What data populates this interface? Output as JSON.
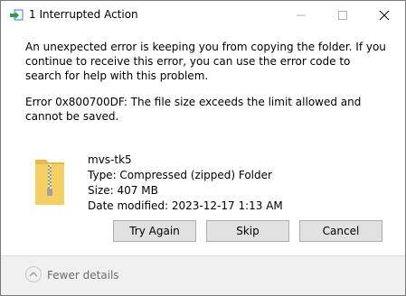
{
  "window": {
    "title": "1 Interrupted Action"
  },
  "message": {
    "line1": "An unexpected error is keeping you from copying the folder. If you continue to receive this error, you can use the error code to search for help with this problem.",
    "line2": "Error 0x800700DF: The file size exceeds the limit allowed and cannot be saved."
  },
  "file": {
    "name": "mvs-tk5",
    "type": "Type: Compressed (zipped) Folder",
    "size": "Size: 407 MB",
    "modified": "Date modified: 2023-12-17 1:13 AM",
    "icon": "zip-folder-icon"
  },
  "buttons": {
    "try_again": "Try Again",
    "skip": "Skip",
    "cancel": "Cancel"
  },
  "footer": {
    "fewer_details": "Fewer details"
  },
  "colors": {
    "folder": "#f4c95a",
    "zipper": "#9a9a9a",
    "button_bg": "#e1e1e1",
    "footer_bg": "#f0f0f0"
  }
}
